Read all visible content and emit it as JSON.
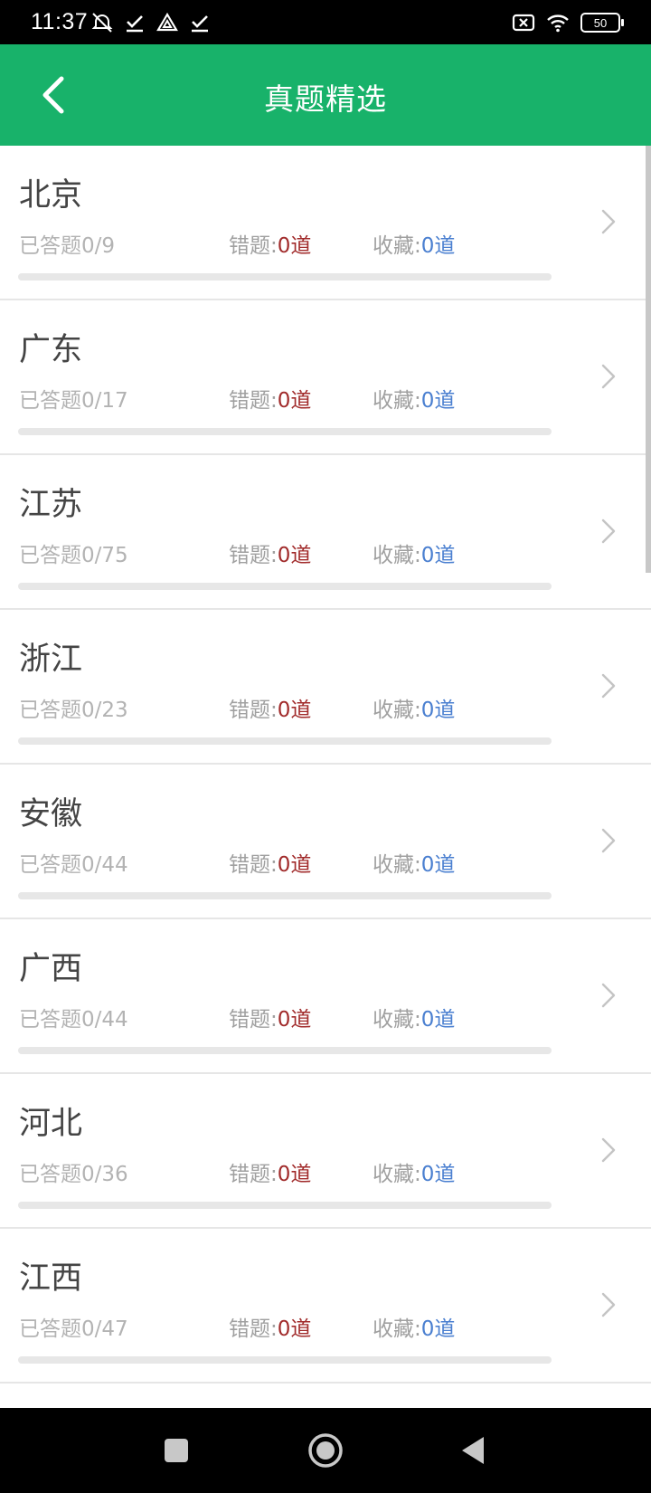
{
  "status_bar": {
    "time": "11:37",
    "battery": "50"
  },
  "header": {
    "title": "真题精选",
    "accent_color": "#18b26a"
  },
  "labels": {
    "wrong_prefix": "错题:",
    "fav_prefix": "收藏:"
  },
  "items": [
    {
      "name": "北京",
      "answered": "已答题0/9",
      "wrong": "0道",
      "fav": "0道",
      "progress": 0
    },
    {
      "name": "广东",
      "answered": "已答题0/17",
      "wrong": "0道",
      "fav": "0道",
      "progress": 0
    },
    {
      "name": "江苏",
      "answered": "已答题0/75",
      "wrong": "0道",
      "fav": "0道",
      "progress": 0
    },
    {
      "name": "浙江",
      "answered": "已答题0/23",
      "wrong": "0道",
      "fav": "0道",
      "progress": 0
    },
    {
      "name": "安徽",
      "answered": "已答题0/44",
      "wrong": "0道",
      "fav": "0道",
      "progress": 0
    },
    {
      "name": "广西",
      "answered": "已答题0/44",
      "wrong": "0道",
      "fav": "0道",
      "progress": 0
    },
    {
      "name": "河北",
      "answered": "已答题0/36",
      "wrong": "0道",
      "fav": "0道",
      "progress": 0
    },
    {
      "name": "江西",
      "answered": "已答题0/47",
      "wrong": "0道",
      "fav": "0道",
      "progress": 0
    }
  ],
  "icons": {
    "back": "back-arrow-icon",
    "row_arrow": "chevron-right-icon",
    "nav_recents": "square-icon",
    "nav_home": "circle-icon",
    "nav_back": "triangle-icon"
  }
}
